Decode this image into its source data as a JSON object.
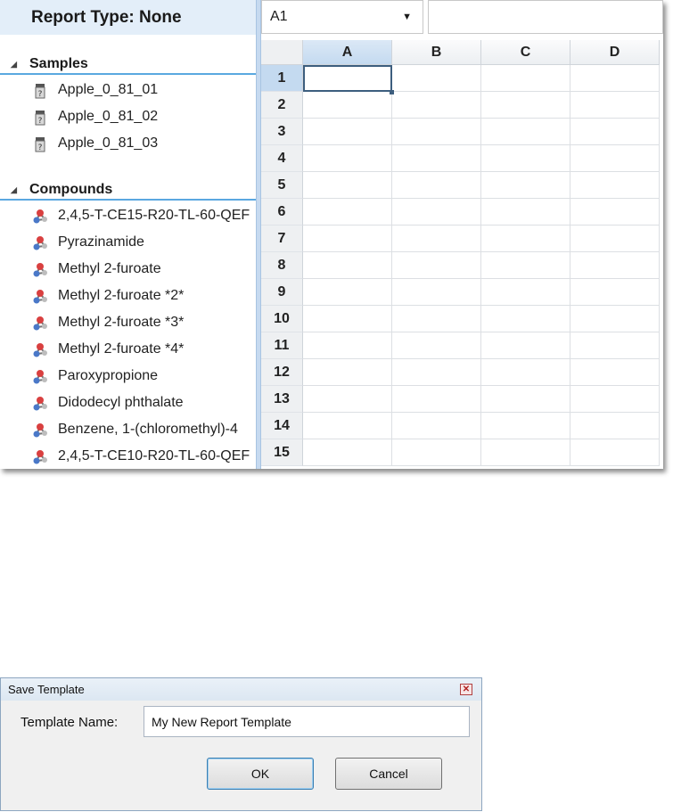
{
  "report_panel": {
    "report_type_label": "Report Type: None",
    "samples": {
      "heading": "Samples",
      "icon": "sample-vial-icon",
      "items": [
        "Apple_0_81_01",
        "Apple_0_81_02",
        "Apple_0_81_03"
      ]
    },
    "compounds": {
      "heading": "Compounds",
      "icon": "molecule-icon",
      "items": [
        "2,4,5-T-CE15-R20-TL-60-QEF",
        "Pyrazinamide",
        "Methyl 2-furoate",
        "Methyl 2-furoate *2*",
        "Methyl 2-furoate *3*",
        "Methyl 2-furoate *4*",
        "Paroxypropione",
        "Didodecyl phthalate",
        "Benzene, 1-(chloromethyl)-4",
        "2,4,5-T-CE10-R20-TL-60-QEF"
      ]
    }
  },
  "spreadsheet": {
    "name_box_value": "A1",
    "formula_value": "",
    "columns": [
      "A",
      "B",
      "C",
      "D"
    ],
    "rows": [
      "1",
      "2",
      "3",
      "4",
      "5",
      "6",
      "7",
      "8",
      "9",
      "10",
      "11",
      "12",
      "13",
      "14",
      "15"
    ],
    "active_cell": "A1",
    "selection_color": "#3d5e7e"
  },
  "dialog": {
    "title": "Save Template",
    "name_label": "Template Name:",
    "name_value": "My New Report Template",
    "ok_label": "OK",
    "cancel_label": "Cancel"
  }
}
